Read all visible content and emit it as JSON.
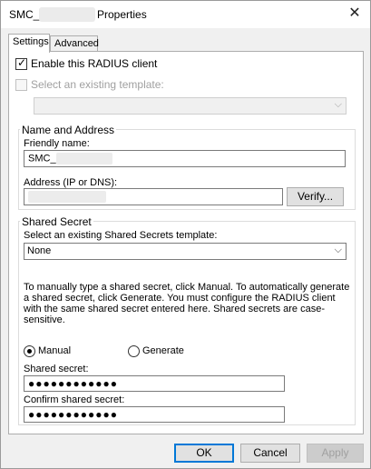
{
  "window": {
    "title_prefix": "SMC_",
    "title_suffix": "Properties",
    "close_glyph": "✕"
  },
  "tabs": [
    {
      "label": "Settings"
    },
    {
      "label": "Advanced"
    }
  ],
  "enable_radius": {
    "label": "Enable this RADIUS client",
    "checked": true
  },
  "existing_template": {
    "label": "Select an existing template:",
    "value": ""
  },
  "name_address": {
    "group_label": "Name and Address",
    "friendly_name_label": "Friendly name:",
    "friendly_name_value": "SMC_",
    "address_label": "Address (IP or DNS):",
    "address_value": "",
    "verify_button": "Verify..."
  },
  "shared_secret": {
    "group_label": "Shared Secret",
    "template_label": "Select an existing Shared Secrets template:",
    "template_value": "None",
    "info_text": "To manually type a shared secret, click Manual. To automatically generate a shared secret, click Generate. You must configure the RADIUS client with the same shared secret entered here. Shared secrets are case-sensitive.",
    "manual_label": "Manual",
    "generate_label": "Generate",
    "secret_label": "Shared secret:",
    "secret_value": "●●●●●●●●●●●●",
    "confirm_label": "Confirm shared secret:",
    "confirm_value": "●●●●●●●●●●●●"
  },
  "buttons": {
    "ok": "OK",
    "cancel": "Cancel",
    "apply": "Apply"
  },
  "icons": {
    "check": "check-icon",
    "dropdown": "chevron-down-icon"
  }
}
